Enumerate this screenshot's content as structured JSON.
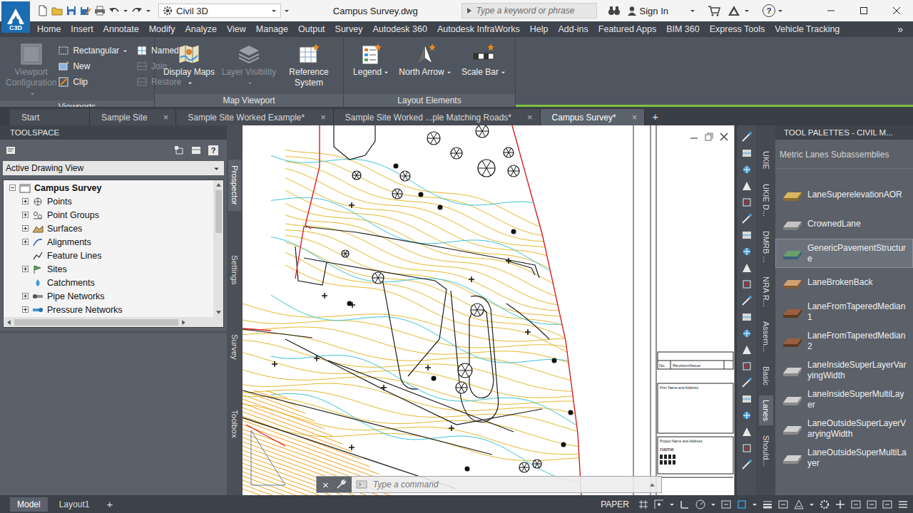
{
  "window": {
    "logo": "C3D",
    "title": "Campus Survey.dwg",
    "help_glyph": "?"
  },
  "workspace": {
    "label": "Civil 3D"
  },
  "search": {
    "placeholder": "Type a keyword or phrase"
  },
  "account": {
    "label": "Sign In"
  },
  "ribbon_tabs": [
    {
      "label": "Home",
      "selected": false
    },
    {
      "label": "Insert",
      "selected": false
    },
    {
      "label": "Annotate",
      "selected": false
    },
    {
      "label": "Modify",
      "selected": false
    },
    {
      "label": "Analyze",
      "selected": false
    },
    {
      "label": "View",
      "selected": false
    },
    {
      "label": "Manage",
      "selected": false
    },
    {
      "label": "Output",
      "selected": false
    },
    {
      "label": "Survey",
      "selected": false
    },
    {
      "label": "Autodesk 360",
      "selected": false
    },
    {
      "label": "Autodesk InfraWorks",
      "selected": false
    },
    {
      "label": "Help",
      "selected": false
    },
    {
      "label": "Add-ins",
      "selected": false
    },
    {
      "label": "Featured Apps",
      "selected": false
    },
    {
      "label": "BIM 360",
      "selected": false
    },
    {
      "label": "Express Tools",
      "selected": false
    },
    {
      "label": "Vehicle Tracking",
      "selected": false
    }
  ],
  "ribbon_overflow": "»",
  "ribbon_panels": [
    {
      "title": "Viewports",
      "large": [
        {
          "label": "Viewport Configuration",
          "disabled": true,
          "dropdown": true
        }
      ],
      "small": [
        {
          "label": "Rectangular",
          "disabled": false,
          "dropdown": true
        },
        {
          "label": "New",
          "disabled": false,
          "dropdown": false
        },
        {
          "label": "Clip",
          "disabled": false,
          "dropdown": false
        },
        {
          "label": "Named",
          "disabled": false,
          "dropdown": false
        },
        {
          "label": "Join",
          "disabled": true,
          "dropdown": false
        },
        {
          "label": "Restore",
          "disabled": true,
          "dropdown": false
        }
      ]
    },
    {
      "title": "Map Viewport",
      "large": [
        {
          "label": "Display Maps",
          "disabled": false,
          "dropdown": true
        },
        {
          "label": "Layer Visibility",
          "disabled": true,
          "dropdown": true
        },
        {
          "label": "Reference System",
          "disabled": false,
          "dropdown": false
        }
      ],
      "small": []
    },
    {
      "title": "Layout Elements",
      "large": [
        {
          "label": "Legend",
          "disabled": false,
          "dropdown": true
        },
        {
          "label": "North Arrow",
          "disabled": false,
          "dropdown": true
        },
        {
          "label": "Scale Bar",
          "disabled": false,
          "dropdown": true
        }
      ],
      "small": []
    }
  ],
  "file_tabs": [
    {
      "label": "Start",
      "selected": false,
      "closable": false
    },
    {
      "label": "Sample Site",
      "selected": false,
      "closable": true
    },
    {
      "label": "Sample Site Worked Example*",
      "selected": false,
      "closable": true
    },
    {
      "label": "Sample Site Worked ...ple Matching Roads*",
      "selected": false,
      "closable": true
    },
    {
      "label": "Campus Survey*",
      "selected": true,
      "closable": true
    }
  ],
  "file_tab_close": "×",
  "file_tab_add": "+",
  "toolspace": {
    "title": "TOOLSPACE",
    "help_glyph": "?",
    "view": "Active Drawing View",
    "tree": {
      "label": "Campus Survey",
      "expanded": true,
      "children": [
        {
          "label": "Points",
          "expandable": true
        },
        {
          "label": "Point Groups",
          "expandable": true
        },
        {
          "label": "Surfaces",
          "expandable": true
        },
        {
          "label": "Alignments",
          "expandable": true
        },
        {
          "label": "Feature Lines",
          "expandable": false
        },
        {
          "label": "Sites",
          "expandable": true
        },
        {
          "label": "Catchments",
          "expandable": false
        },
        {
          "label": "Pipe Networks",
          "expandable": true
        },
        {
          "label": "Pressure Networks",
          "expandable": true
        }
      ]
    }
  },
  "toolspace_tabs": [
    {
      "label": "Prospector",
      "selected": true
    },
    {
      "label": "Settings",
      "selected": false
    },
    {
      "label": "Survey",
      "selected": false
    },
    {
      "label": "Toolbox",
      "selected": false
    }
  ],
  "drawing": {
    "title_block": {
      "no": "No.",
      "revision": "Revision/Issue",
      "firm": "Firm Name and Address",
      "project": "Project Name and Address",
      "name": "name"
    }
  },
  "command_line": {
    "placeholder": "Type a command",
    "close_glyph": "×"
  },
  "palette": {
    "title": "TOOL PALETTES - CIVIL M...",
    "subtitle": "Metric Lanes Subassemblies",
    "items": [
      {
        "label": "LaneSuperelevationAOR",
        "selected": false
      },
      {
        "label": "CrownedLane",
        "selected": false
      },
      {
        "label": "GenericPavementStructure",
        "selected": true
      },
      {
        "label": "LaneBrokenBack",
        "selected": false
      },
      {
        "label": "LaneFromTaperedMedian1",
        "selected": false
      },
      {
        "label": "LaneFromTaperedMedian2",
        "selected": false
      },
      {
        "label": "LaneInsideSuperLayerVaryingWidth",
        "selected": false
      },
      {
        "label": "LaneInsideSuperMultiLayer",
        "selected": false
      },
      {
        "label": "LaneOutsideSuperLayerVaryingWidth",
        "selected": false
      },
      {
        "label": "LaneOutsideSuperMultiLayer",
        "selected": false
      }
    ]
  },
  "palette_tabs": [
    {
      "label": "UKIE",
      "selected": false
    },
    {
      "label": "UKIE D...",
      "selected": false
    },
    {
      "label": "DMRB ...",
      "selected": false
    },
    {
      "label": "NRA R...",
      "selected": false
    },
    {
      "label": "Assem...",
      "selected": false
    },
    {
      "label": "Basic",
      "selected": false
    },
    {
      "label": "Lanes",
      "selected": true
    },
    {
      "label": "Should...",
      "selected": false
    }
  ],
  "layout_tabs": [
    {
      "label": "Model",
      "selected": true
    },
    {
      "label": "Layout1",
      "selected": false
    }
  ],
  "layout_add": "+",
  "status_bar": {
    "space": "PAPER"
  }
}
